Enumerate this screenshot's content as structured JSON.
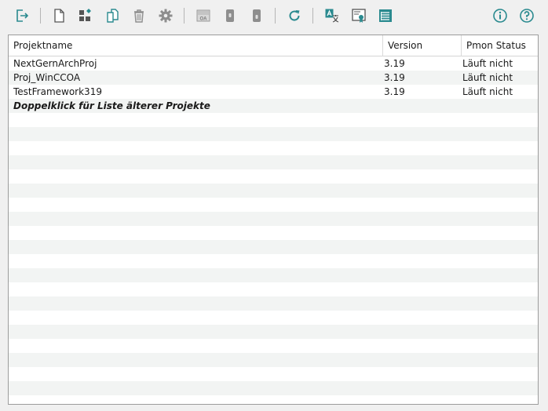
{
  "toolbar": {
    "buttons": [
      {
        "id": "exit",
        "icon": "exit-icon"
      },
      {
        "id": "new-project",
        "icon": "new-document-icon"
      },
      {
        "id": "add-project",
        "icon": "add-grid-icon"
      },
      {
        "id": "copy-project",
        "icon": "copy-icon"
      },
      {
        "id": "delete-project",
        "icon": "trash-icon"
      },
      {
        "id": "settings",
        "icon": "gear-icon"
      },
      {
        "id": "wincc-oa",
        "icon": "wincc-oa-icon",
        "label": "OA"
      },
      {
        "id": "device-1",
        "icon": "device-icon"
      },
      {
        "id": "device-2",
        "icon": "device-icon"
      },
      {
        "id": "refresh",
        "icon": "refresh-icon"
      },
      {
        "id": "language",
        "icon": "translate-icon"
      },
      {
        "id": "certificate",
        "icon": "certificate-icon"
      },
      {
        "id": "log-list",
        "icon": "list-icon"
      },
      {
        "id": "info",
        "icon": "info-icon"
      },
      {
        "id": "help",
        "icon": "help-icon"
      }
    ]
  },
  "table": {
    "headers": {
      "name": "Projektname",
      "version": "Version",
      "status": "Pmon Status"
    },
    "rows": [
      {
        "name": "NextGernArchProj",
        "version": "3.19",
        "status": "Läuft nicht"
      },
      {
        "name": "Proj_WinCCOA",
        "version": "3.19",
        "status": "Läuft nicht"
      },
      {
        "name": "TestFramework319",
        "version": "3.19",
        "status": "Läuft nicht"
      }
    ],
    "hint": "Doppelklick für Liste älterer Projekte"
  },
  "colors": {
    "accent": "#2a8a8f",
    "stripe": "#f2f4f3",
    "icon_gray": "#8e8e8e"
  }
}
